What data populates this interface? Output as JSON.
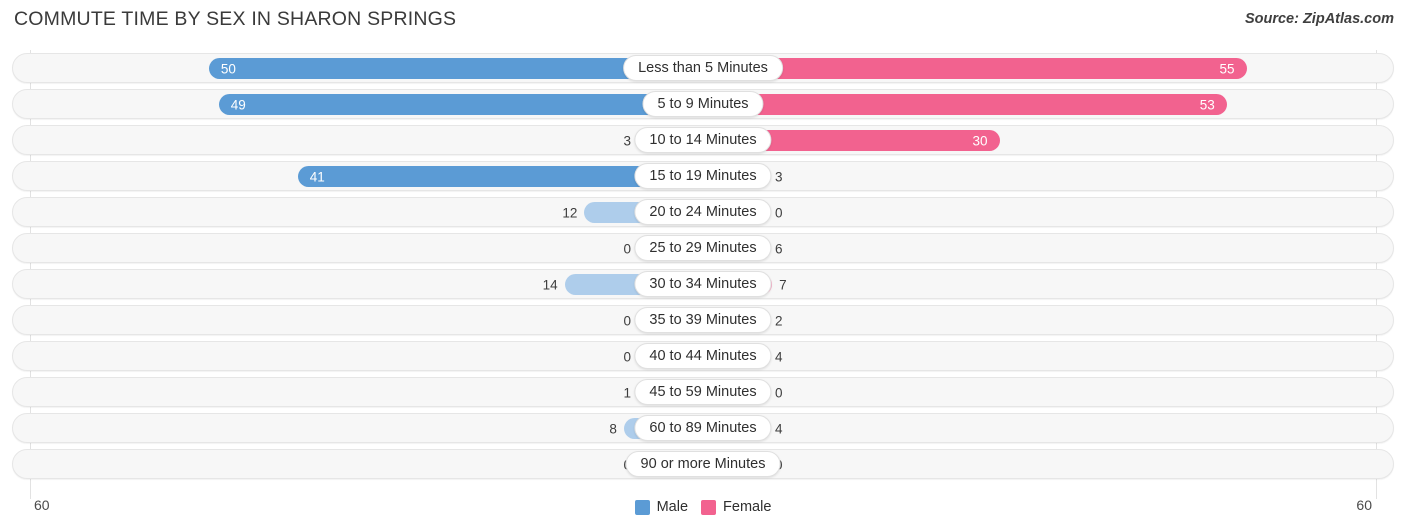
{
  "header": {
    "title": "COMMUTE TIME BY SEX IN SHARON SPRINGS",
    "source": "Source: ZipAtlas.com"
  },
  "axis": {
    "left_max_label": "60",
    "right_max_label": "60"
  },
  "legend": {
    "items": [
      {
        "label": "Male",
        "color": "#5b9bd5"
      },
      {
        "label": "Female",
        "color": "#f2628f"
      }
    ]
  },
  "colors": {
    "male_strong": "#5b9bd5",
    "male_light": "#aecdeb",
    "female_strong": "#f2628f",
    "female_light": "#f9a2c0",
    "track": "#f7f7f7",
    "track_border": "#e6e6e6",
    "gridline": "#e2e2e2"
  },
  "chart_data": {
    "type": "bar",
    "title": "COMMUTE TIME BY SEX IN SHARON SPRINGS",
    "subtitle": "Source: ZipAtlas.com",
    "orientation": "horizontal-diverging",
    "xlabel": "",
    "ylabel": "",
    "xlim": [
      60,
      60
    ],
    "grid": true,
    "legend_position": "bottom-center",
    "categories": [
      "Less than 5 Minutes",
      "5 to 9 Minutes",
      "10 to 14 Minutes",
      "15 to 19 Minutes",
      "20 to 24 Minutes",
      "25 to 29 Minutes",
      "30 to 34 Minutes",
      "35 to 39 Minutes",
      "40 to 44 Minutes",
      "45 to 59 Minutes",
      "60 to 89 Minutes",
      "90 or more Minutes"
    ],
    "series": [
      {
        "name": "Male",
        "values": [
          50,
          49,
          3,
          41,
          12,
          0,
          14,
          0,
          0,
          1,
          8,
          0
        ]
      },
      {
        "name": "Female",
        "values": [
          55,
          53,
          30,
          3,
          0,
          6,
          7,
          2,
          4,
          0,
          4,
          0
        ]
      }
    ]
  }
}
